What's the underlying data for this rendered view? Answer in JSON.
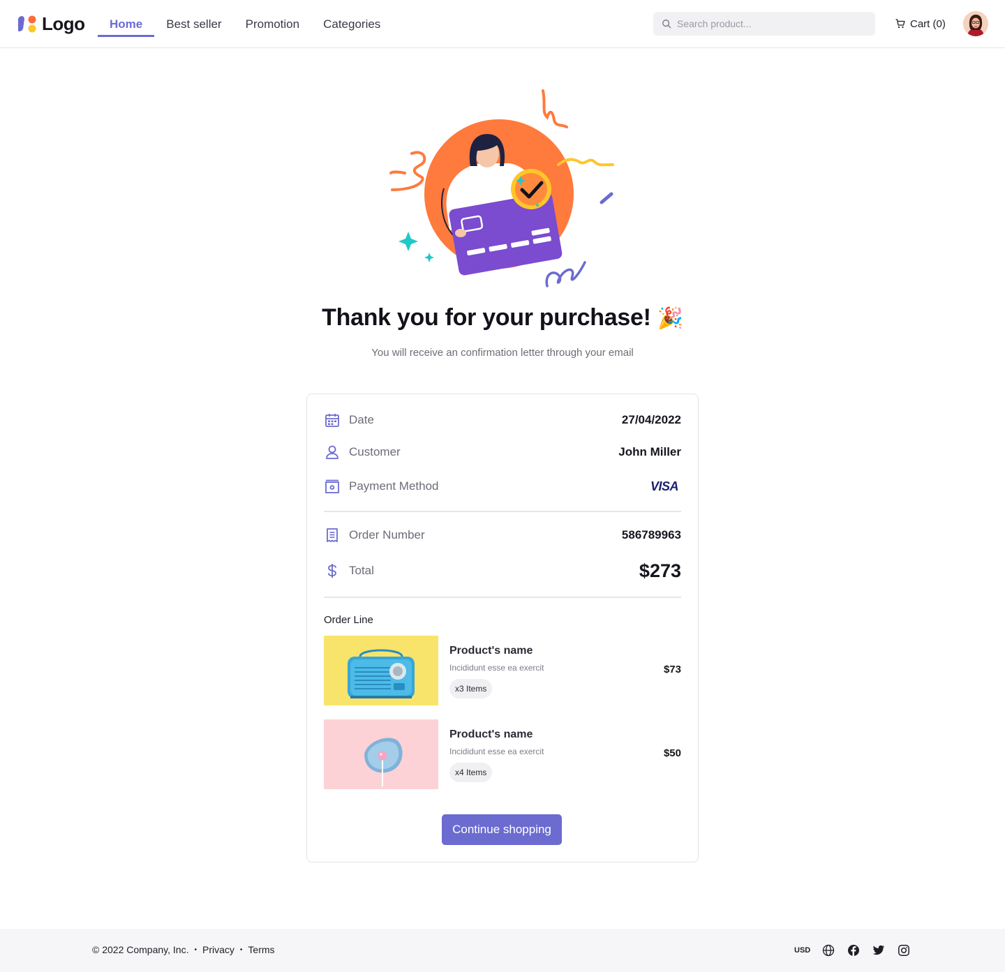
{
  "header": {
    "logo_text": "Logo",
    "nav": [
      {
        "label": "Home",
        "active": true
      },
      {
        "label": "Best seller",
        "active": false
      },
      {
        "label": "Promotion",
        "active": false
      },
      {
        "label": "Categories",
        "active": false
      }
    ],
    "search_placeholder": "Search product...",
    "cart_label": "Cart (0)"
  },
  "hero": {
    "title": "Thank you for your purchase!",
    "title_emoji": "🎉",
    "subtitle": "You will receive an confirmation letter through your email"
  },
  "order": {
    "date_label": "Date",
    "date_value": "27/04/2022",
    "customer_label": "Customer",
    "customer_value": "John Miller",
    "payment_label": "Payment Method",
    "payment_value": "VISA",
    "order_number_label": "Order Number",
    "order_number_value": "586789963",
    "total_label": "Total",
    "total_value": "$273",
    "order_line_title": "Order Line",
    "items": [
      {
        "name": "Product's name",
        "description": "Incididunt esse ea exercit",
        "quantity": "x3 Items",
        "price": "$73",
        "thumb": "blue-radio-on-yellow"
      },
      {
        "name": "Product's name",
        "description": "Incididunt esse ea exercit",
        "quantity": "x4 Items",
        "price": "$50",
        "thumb": "pink-lollipop-on-blue-plate"
      }
    ],
    "cta_label": "Continue shopping"
  },
  "footer": {
    "copyright": "© 2022 Company, Inc.",
    "privacy": "Privacy",
    "terms": "Terms",
    "currency": "USD",
    "icons": [
      "globe-icon",
      "facebook-icon",
      "twitter-icon",
      "instagram-icon"
    ]
  },
  "colors": {
    "accent": "#6b6bd0",
    "hero_orange": "#ff7a3d",
    "card_purple": "#7b4bd0"
  }
}
